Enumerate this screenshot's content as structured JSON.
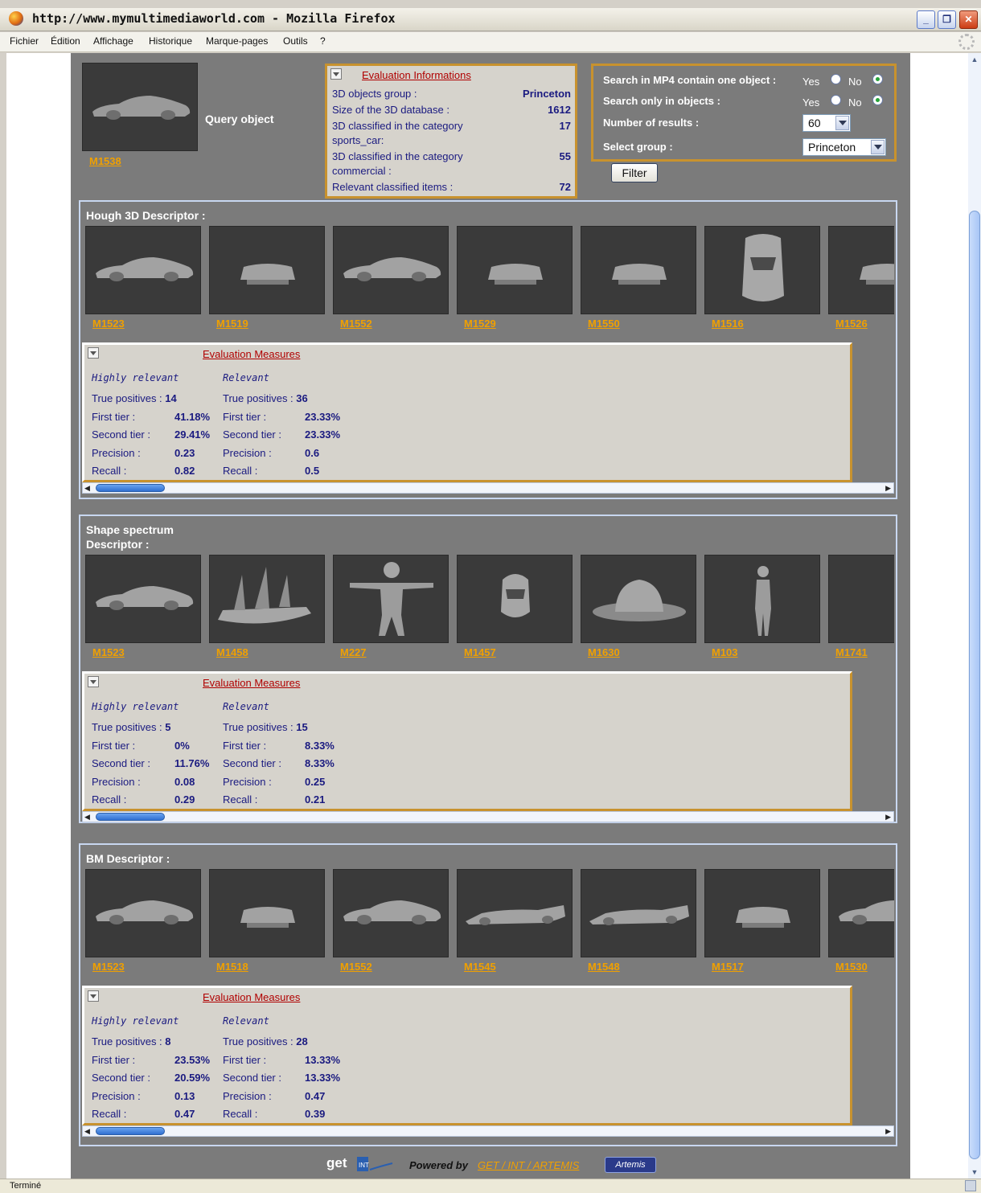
{
  "window": {
    "title": "http://www.mymultimediaworld.com - Mozilla Firefox",
    "buttons": {
      "minimize": "_",
      "restore": "❐",
      "close": "✕"
    }
  },
  "menu": [
    "Fichier",
    "Édition",
    "Affichage",
    "Historique",
    "Marque-pages",
    "Outils",
    "?"
  ],
  "status": "Terminé",
  "query": {
    "id": "M1538",
    "label": "Query object"
  },
  "evaluation_info": {
    "title": "Evaluation Informations",
    "rows": [
      {
        "label": "3D objects group :",
        "value": "Princeton"
      },
      {
        "label": "Size of the 3D database :",
        "value": "1612"
      },
      {
        "label": "3D classified in the category",
        "label2": "sports_car:",
        "value": "17"
      },
      {
        "label": "3D classified in the category",
        "label2": "commercial :",
        "value": "55"
      },
      {
        "label": "Relevant classified items :",
        "value": "72"
      }
    ]
  },
  "search": {
    "rows": [
      {
        "label": "Search in MP4 contain one object :",
        "yes": "Yes",
        "no": "No",
        "selected": "no"
      },
      {
        "label": "Search only in objects :",
        "yes": "Yes",
        "no": "No",
        "selected": "no"
      }
    ],
    "results_label": "Number of results :",
    "results_value": "60",
    "group_label": "Select group :",
    "group_value": "Princeton",
    "filter_button": "Filter"
  },
  "descriptors": [
    {
      "title": "Hough 3D Descriptor :",
      "results": [
        {
          "id": "M1523",
          "icon": "car-side-icon"
        },
        {
          "id": "M1519",
          "icon": "car-front-icon"
        },
        {
          "id": "M1552",
          "icon": "car-side-icon"
        },
        {
          "id": "M1529",
          "icon": "car-front-icon"
        },
        {
          "id": "M1550",
          "icon": "car-front-icon"
        },
        {
          "id": "M1516",
          "icon": "car-top-icon"
        },
        {
          "id": "M1526",
          "icon": "car-front-icon"
        }
      ],
      "measures": {
        "title": "Evaluation Measures",
        "highly_label": "Highly relevant",
        "relevant_label": "Relevant",
        "keys": [
          "True positives :",
          "First tier :",
          "Second tier :",
          "Precision :",
          "Recall :"
        ],
        "highly": [
          "14",
          "41.18%",
          "29.41%",
          "0.23",
          "0.82"
        ],
        "relevant": [
          "36",
          "23.33%",
          "23.33%",
          "0.6",
          "0.5"
        ]
      }
    },
    {
      "title": "Shape spectrum Descriptor :",
      "results": [
        {
          "id": "M1523",
          "icon": "car-side-icon"
        },
        {
          "id": "M1458",
          "icon": "ship-icon"
        },
        {
          "id": "M227",
          "icon": "humanoid-icon"
        },
        {
          "id": "M1457",
          "icon": "helmet-icon"
        },
        {
          "id": "M1630",
          "icon": "hat-icon"
        },
        {
          "id": "M103",
          "icon": "standing-figure-icon"
        },
        {
          "id": "M1741",
          "icon": "head-icon"
        }
      ],
      "measures": {
        "title": "Evaluation Measures",
        "highly_label": "Highly relevant",
        "relevant_label": "Relevant",
        "keys": [
          "True positives :",
          "First tier :",
          "Second tier :",
          "Precision :",
          "Recall :"
        ],
        "highly": [
          "5",
          "0%",
          "11.76%",
          "0.08",
          "0.29"
        ],
        "relevant": [
          "15",
          "8.33%",
          "8.33%",
          "0.25",
          "0.21"
        ]
      }
    },
    {
      "title": "BM Descriptor :",
      "results": [
        {
          "id": "M1523",
          "icon": "car-side-icon"
        },
        {
          "id": "M1518",
          "icon": "car-front-icon"
        },
        {
          "id": "M1552",
          "icon": "car-side-icon"
        },
        {
          "id": "M1545",
          "icon": "race-car-side-icon"
        },
        {
          "id": "M1548",
          "icon": "race-car-side-icon"
        },
        {
          "id": "M1517",
          "icon": "car-front-icon"
        },
        {
          "id": "M1530",
          "icon": "car-side-icon"
        }
      ],
      "measures": {
        "title": "Evaluation Measures",
        "highly_label": "Highly relevant",
        "relevant_label": "Relevant",
        "keys": [
          "True positives :",
          "First tier :",
          "Second tier :",
          "Precision :",
          "Recall :"
        ],
        "highly": [
          "8",
          "23.53%",
          "20.59%",
          "0.13",
          "0.47"
        ],
        "relevant": [
          "28",
          "13.33%",
          "13.33%",
          "0.47",
          "0.39"
        ]
      }
    }
  ],
  "footer": {
    "logo_get": "get",
    "logo_int": "INT",
    "powered_by": "Powered by",
    "powered_link": "GET / INT / ARTEMIS",
    "logo_artemis": "Artemis"
  }
}
